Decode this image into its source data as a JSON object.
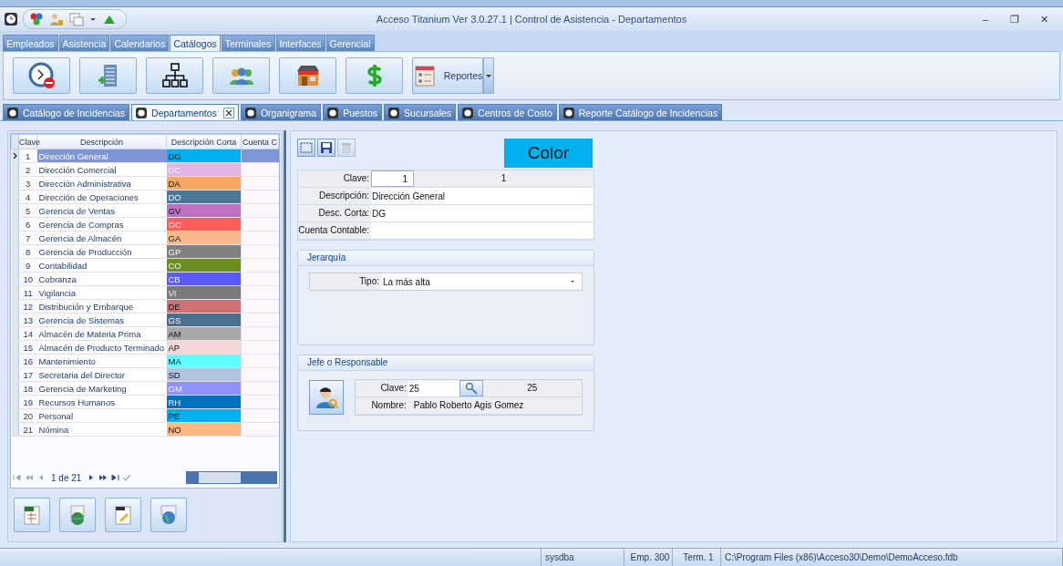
{
  "window": {
    "title": "Acceso Titanium  Ver 3.0.27.1 | Control de Asistencia - Departamentos",
    "controls": [
      "–",
      "❐",
      "✕"
    ]
  },
  "ribbon_tabs": [
    {
      "label": "Empleados",
      "selected": false
    },
    {
      "label": "Asistencia",
      "selected": false
    },
    {
      "label": "Calendarios",
      "selected": false
    },
    {
      "label": "Catálogos",
      "selected": true
    },
    {
      "label": "Terminales",
      "selected": false
    },
    {
      "label": "Interfaces",
      "selected": false
    },
    {
      "label": "Gerencial",
      "selected": false
    }
  ],
  "ribbon_buttons": [
    {
      "kind": "clock"
    },
    {
      "kind": "building"
    },
    {
      "kind": "org"
    },
    {
      "kind": "people"
    },
    {
      "kind": "store"
    },
    {
      "kind": "dollar"
    },
    {
      "kind": "report",
      "label": "Reportes"
    }
  ],
  "doc_tabs": [
    {
      "label": "Catálogo de Incidencias",
      "selected": false
    },
    {
      "label": "Departamentos",
      "selected": true
    },
    {
      "label": "Organigrama",
      "selected": false
    },
    {
      "label": "Puestos",
      "selected": false
    },
    {
      "label": "Sucursales",
      "selected": false
    },
    {
      "label": "Centros de Costo",
      "selected": false
    },
    {
      "label": "Reporte Catálogo de Incidencias",
      "selected": false
    }
  ],
  "table": {
    "columns": [
      "Clave",
      "Descripción",
      "Descripción Corta",
      "Cuenta C"
    ],
    "rows": [
      {
        "clave": "1",
        "descripcion": "Dirección General",
        "corta": "DG",
        "color": "#00b0f0",
        "light_text": false,
        "selected": true
      },
      {
        "clave": "2",
        "descripcion": "Dirección Comercial",
        "corta": "DC",
        "color": "#e2b4e2",
        "light_text": true,
        "selected": false
      },
      {
        "clave": "3",
        "descripcion": "Dirección Administrativa",
        "corta": "DA",
        "color": "#f4a860",
        "light_text": false,
        "selected": false
      },
      {
        "clave": "4",
        "descripcion": "Dirección de Operaciones",
        "corta": "DO",
        "color": "#4a7898",
        "light_text": true,
        "selected": false
      },
      {
        "clave": "5",
        "descripcion": "Gerencia de Ventas",
        "corta": "GV",
        "color": "#c070c0",
        "light_text": false,
        "selected": false
      },
      {
        "clave": "6",
        "descripcion": "Gerencia de Compras",
        "corta": "GC",
        "color": "#ff5c5c",
        "light_text": true,
        "selected": false
      },
      {
        "clave": "7",
        "descripcion": "Gerencia de Almacén",
        "corta": "GA",
        "color": "#f8b888",
        "light_text": false,
        "selected": false
      },
      {
        "clave": "8",
        "descripcion": "Gerencia de Producción",
        "corta": "GP",
        "color": "#808080",
        "light_text": true,
        "selected": false
      },
      {
        "clave": "9",
        "descripcion": "Contabilidad",
        "corta": "CO",
        "color": "#6b8e23",
        "light_text": true,
        "selected": false
      },
      {
        "clave": "10",
        "descripcion": "Cobranza",
        "corta": "CB",
        "color": "#5a5aff",
        "light_text": true,
        "selected": false
      },
      {
        "clave": "11",
        "descripcion": "Vigilancia",
        "corta": "VI",
        "color": "#7a7a7a",
        "light_text": true,
        "selected": false
      },
      {
        "clave": "12",
        "descripcion": "Distribución y Embarque",
        "corta": "DE",
        "color": "#d07070",
        "light_text": false,
        "selected": false
      },
      {
        "clave": "13",
        "descripcion": "Gerencia de Sistemas",
        "corta": "GS",
        "color": "#4a7090",
        "light_text": true,
        "selected": false
      },
      {
        "clave": "14",
        "descripcion": "Almacén de Materia Prima",
        "corta": "AM",
        "color": "#a8a8a8",
        "light_text": false,
        "selected": false
      },
      {
        "clave": "15",
        "descripcion": "Almacén de Producto Terminado",
        "corta": "AP",
        "color": "#f4d8d8",
        "light_text": false,
        "selected": false
      },
      {
        "clave": "16",
        "descripcion": "Mantenimiento",
        "corta": "MA",
        "color": "#60ffff",
        "light_text": false,
        "selected": false
      },
      {
        "clave": "17",
        "descripcion": "Secretaria del Director",
        "corta": "SD",
        "color": "#b0c4de",
        "light_text": false,
        "selected": false
      },
      {
        "clave": "18",
        "descripcion": "Gerencia de Marketing",
        "corta": "GM",
        "color": "#9090ff",
        "light_text": true,
        "selected": false
      },
      {
        "clave": "19",
        "descripcion": "Recursos Humanos",
        "corta": "RH",
        "color": "#0070c0",
        "light_text": true,
        "selected": false
      },
      {
        "clave": "20",
        "descripcion": "Personal",
        "corta": "PE",
        "color": "#00b0f0",
        "light_text": false,
        "selected": false
      },
      {
        "clave": "21",
        "descripcion": "Nómina",
        "corta": "NO",
        "color": "#ffb880",
        "light_text": false,
        "selected": false
      }
    ]
  },
  "navigator": {
    "position": "1 de 21"
  },
  "export_buttons": [
    {
      "kind": "xls"
    },
    {
      "kind": "html"
    },
    {
      "kind": "txt"
    },
    {
      "kind": "web"
    }
  ],
  "form": {
    "toolbar": [
      {
        "kind": "new",
        "disabled": false
      },
      {
        "kind": "save",
        "disabled": false
      },
      {
        "kind": "delete",
        "disabled": true
      }
    ],
    "color_button": {
      "label": "Color",
      "color": "#00b0f0"
    },
    "clave": {
      "label": "Clave:",
      "value": "1",
      "display": "1"
    },
    "descripcion": {
      "label": "Descripción:",
      "value": "Dirección General"
    },
    "corta": {
      "label": "Desc. Corta:",
      "value": "DG"
    },
    "cuenta": {
      "label": "Cuenta Contable:"
    },
    "jerarquia": {
      "title": "Jerarquía",
      "label": "Tipo:",
      "value": "La más alta"
    },
    "jefe": {
      "title": "Jefe o Responsable",
      "clave_label": "Clave:",
      "clave": "25",
      "clave_display": "25",
      "nombre_label": "Nombre:",
      "nombre": "Pablo Roberto Agis Gomez"
    }
  },
  "status_bar": [
    "sysdba",
    "Emp. 300",
    "Term. 1",
    "C:\\Program Files (x86)\\Acceso30\\Demo\\DemoAcceso.fdb"
  ]
}
